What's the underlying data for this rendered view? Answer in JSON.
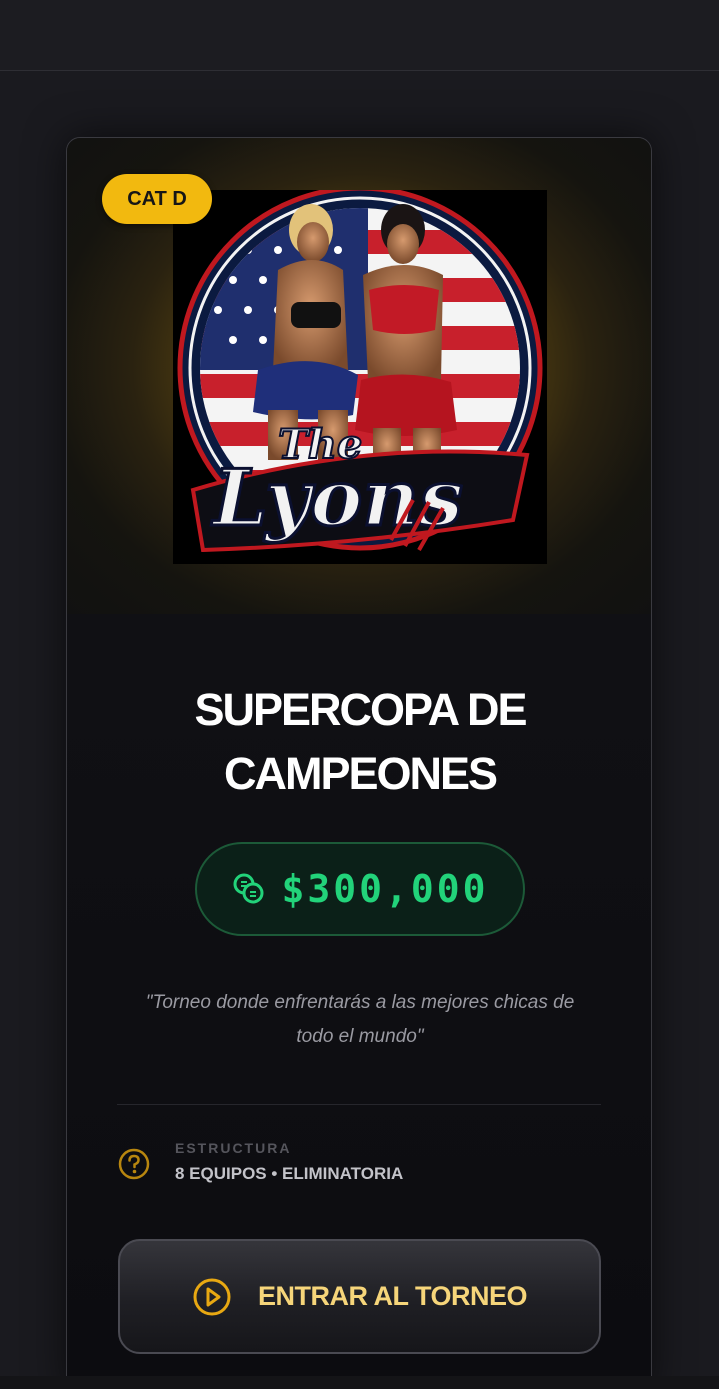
{
  "tournament": {
    "category_badge": "CAT D",
    "hero_logo_text": "The Lyons",
    "title_line1": "SUPERCOPA DE",
    "title_line2": "CAMPEONES",
    "prize": "$300,000",
    "quote_line1": "\"Torneo donde enfrentarás a las mejores chicas de",
    "quote_line2": "todo el mundo\"",
    "structure_label": "ESTRUCTURA",
    "structure_value": "8 EQUIPOS • ELIMINATORIA",
    "cta_label": "ENTRAR AL TORNEO"
  },
  "icons": {
    "prize": "coins-icon",
    "structure": "question-circle-icon",
    "cta": "play-circle-icon"
  },
  "colors": {
    "badge": "#f2b90f",
    "prize_text": "#22d37a",
    "cta_text": "#f6d57a",
    "accent_gold": "#d9a413"
  }
}
